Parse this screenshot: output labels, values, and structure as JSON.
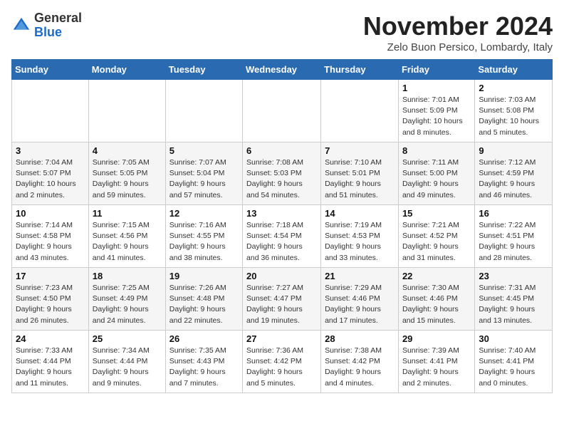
{
  "header": {
    "logo_line1": "General",
    "logo_line2": "Blue",
    "month": "November 2024",
    "location": "Zelo Buon Persico, Lombardy, Italy"
  },
  "weekdays": [
    "Sunday",
    "Monday",
    "Tuesday",
    "Wednesday",
    "Thursday",
    "Friday",
    "Saturday"
  ],
  "weeks": [
    [
      {
        "day": "",
        "info": ""
      },
      {
        "day": "",
        "info": ""
      },
      {
        "day": "",
        "info": ""
      },
      {
        "day": "",
        "info": ""
      },
      {
        "day": "",
        "info": ""
      },
      {
        "day": "1",
        "info": "Sunrise: 7:01 AM\nSunset: 5:09 PM\nDaylight: 10 hours\nand 8 minutes."
      },
      {
        "day": "2",
        "info": "Sunrise: 7:03 AM\nSunset: 5:08 PM\nDaylight: 10 hours\nand 5 minutes."
      }
    ],
    [
      {
        "day": "3",
        "info": "Sunrise: 7:04 AM\nSunset: 5:07 PM\nDaylight: 10 hours\nand 2 minutes."
      },
      {
        "day": "4",
        "info": "Sunrise: 7:05 AM\nSunset: 5:05 PM\nDaylight: 9 hours\nand 59 minutes."
      },
      {
        "day": "5",
        "info": "Sunrise: 7:07 AM\nSunset: 5:04 PM\nDaylight: 9 hours\nand 57 minutes."
      },
      {
        "day": "6",
        "info": "Sunrise: 7:08 AM\nSunset: 5:03 PM\nDaylight: 9 hours\nand 54 minutes."
      },
      {
        "day": "7",
        "info": "Sunrise: 7:10 AM\nSunset: 5:01 PM\nDaylight: 9 hours\nand 51 minutes."
      },
      {
        "day": "8",
        "info": "Sunrise: 7:11 AM\nSunset: 5:00 PM\nDaylight: 9 hours\nand 49 minutes."
      },
      {
        "day": "9",
        "info": "Sunrise: 7:12 AM\nSunset: 4:59 PM\nDaylight: 9 hours\nand 46 minutes."
      }
    ],
    [
      {
        "day": "10",
        "info": "Sunrise: 7:14 AM\nSunset: 4:58 PM\nDaylight: 9 hours\nand 43 minutes."
      },
      {
        "day": "11",
        "info": "Sunrise: 7:15 AM\nSunset: 4:56 PM\nDaylight: 9 hours\nand 41 minutes."
      },
      {
        "day": "12",
        "info": "Sunrise: 7:16 AM\nSunset: 4:55 PM\nDaylight: 9 hours\nand 38 minutes."
      },
      {
        "day": "13",
        "info": "Sunrise: 7:18 AM\nSunset: 4:54 PM\nDaylight: 9 hours\nand 36 minutes."
      },
      {
        "day": "14",
        "info": "Sunrise: 7:19 AM\nSunset: 4:53 PM\nDaylight: 9 hours\nand 33 minutes."
      },
      {
        "day": "15",
        "info": "Sunrise: 7:21 AM\nSunset: 4:52 PM\nDaylight: 9 hours\nand 31 minutes."
      },
      {
        "day": "16",
        "info": "Sunrise: 7:22 AM\nSunset: 4:51 PM\nDaylight: 9 hours\nand 28 minutes."
      }
    ],
    [
      {
        "day": "17",
        "info": "Sunrise: 7:23 AM\nSunset: 4:50 PM\nDaylight: 9 hours\nand 26 minutes."
      },
      {
        "day": "18",
        "info": "Sunrise: 7:25 AM\nSunset: 4:49 PM\nDaylight: 9 hours\nand 24 minutes."
      },
      {
        "day": "19",
        "info": "Sunrise: 7:26 AM\nSunset: 4:48 PM\nDaylight: 9 hours\nand 22 minutes."
      },
      {
        "day": "20",
        "info": "Sunrise: 7:27 AM\nSunset: 4:47 PM\nDaylight: 9 hours\nand 19 minutes."
      },
      {
        "day": "21",
        "info": "Sunrise: 7:29 AM\nSunset: 4:46 PM\nDaylight: 9 hours\nand 17 minutes."
      },
      {
        "day": "22",
        "info": "Sunrise: 7:30 AM\nSunset: 4:46 PM\nDaylight: 9 hours\nand 15 minutes."
      },
      {
        "day": "23",
        "info": "Sunrise: 7:31 AM\nSunset: 4:45 PM\nDaylight: 9 hours\nand 13 minutes."
      }
    ],
    [
      {
        "day": "24",
        "info": "Sunrise: 7:33 AM\nSunset: 4:44 PM\nDaylight: 9 hours\nand 11 minutes."
      },
      {
        "day": "25",
        "info": "Sunrise: 7:34 AM\nSunset: 4:44 PM\nDaylight: 9 hours\nand 9 minutes."
      },
      {
        "day": "26",
        "info": "Sunrise: 7:35 AM\nSunset: 4:43 PM\nDaylight: 9 hours\nand 7 minutes."
      },
      {
        "day": "27",
        "info": "Sunrise: 7:36 AM\nSunset: 4:42 PM\nDaylight: 9 hours\nand 5 minutes."
      },
      {
        "day": "28",
        "info": "Sunrise: 7:38 AM\nSunset: 4:42 PM\nDaylight: 9 hours\nand 4 minutes."
      },
      {
        "day": "29",
        "info": "Sunrise: 7:39 AM\nSunset: 4:41 PM\nDaylight: 9 hours\nand 2 minutes."
      },
      {
        "day": "30",
        "info": "Sunrise: 7:40 AM\nSunset: 4:41 PM\nDaylight: 9 hours\nand 0 minutes."
      }
    ]
  ]
}
